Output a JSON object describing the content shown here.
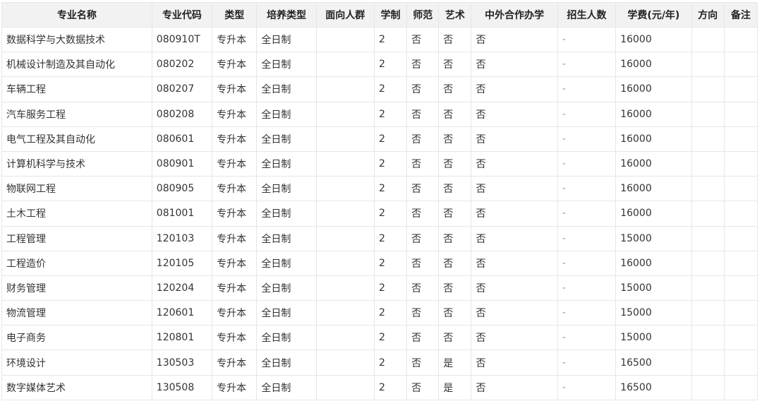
{
  "columns": [
    "专业名称",
    "专业代码",
    "类型",
    "培养类型",
    "面向人群",
    "学制",
    "师范",
    "艺术",
    "中外合作办学",
    "招生人数",
    "学费(元/年)",
    "方向",
    "备注"
  ],
  "rows": [
    [
      "数据科学与大数据技术",
      "080910T",
      "专升本",
      "全日制",
      "",
      "2",
      "否",
      "否",
      "否",
      "-",
      "16000",
      "",
      ""
    ],
    [
      "机械设计制造及其自动化",
      "080202",
      "专升本",
      "全日制",
      "",
      "2",
      "否",
      "否",
      "否",
      "-",
      "16000",
      "",
      ""
    ],
    [
      "车辆工程",
      "080207",
      "专升本",
      "全日制",
      "",
      "2",
      "否",
      "否",
      "否",
      "-",
      "16000",
      "",
      ""
    ],
    [
      "汽车服务工程",
      "080208",
      "专升本",
      "全日制",
      "",
      "2",
      "否",
      "否",
      "否",
      "-",
      "16000",
      "",
      ""
    ],
    [
      "电气工程及其自动化",
      "080601",
      "专升本",
      "全日制",
      "",
      "2",
      "否",
      "否",
      "否",
      "-",
      "16000",
      "",
      ""
    ],
    [
      "计算机科学与技术",
      "080901",
      "专升本",
      "全日制",
      "",
      "2",
      "否",
      "否",
      "否",
      "-",
      "16000",
      "",
      ""
    ],
    [
      "物联网工程",
      "080905",
      "专升本",
      "全日制",
      "",
      "2",
      "否",
      "否",
      "否",
      "-",
      "16000",
      "",
      ""
    ],
    [
      "土木工程",
      "081001",
      "专升本",
      "全日制",
      "",
      "2",
      "否",
      "否",
      "否",
      "-",
      "16000",
      "",
      ""
    ],
    [
      "工程管理",
      "120103",
      "专升本",
      "全日制",
      "",
      "2",
      "否",
      "否",
      "否",
      "-",
      "15000",
      "",
      ""
    ],
    [
      "工程造价",
      "120105",
      "专升本",
      "全日制",
      "",
      "2",
      "否",
      "否",
      "否",
      "-",
      "16000",
      "",
      ""
    ],
    [
      "财务管理",
      "120204",
      "专升本",
      "全日制",
      "",
      "2",
      "否",
      "否",
      "否",
      "-",
      "15000",
      "",
      ""
    ],
    [
      "物流管理",
      "120601",
      "专升本",
      "全日制",
      "",
      "2",
      "否",
      "否",
      "否",
      "-",
      "15000",
      "",
      ""
    ],
    [
      "电子商务",
      "120801",
      "专升本",
      "全日制",
      "",
      "2",
      "否",
      "否",
      "否",
      "-",
      "15000",
      "",
      ""
    ],
    [
      "环境设计",
      "130503",
      "专升本",
      "全日制",
      "",
      "2",
      "否",
      "是",
      "否",
      "-",
      "16500",
      "",
      ""
    ],
    [
      "数字媒体艺术",
      "130508",
      "专升本",
      "全日制",
      "",
      "2",
      "否",
      "是",
      "否",
      "-",
      "16500",
      "",
      ""
    ]
  ]
}
